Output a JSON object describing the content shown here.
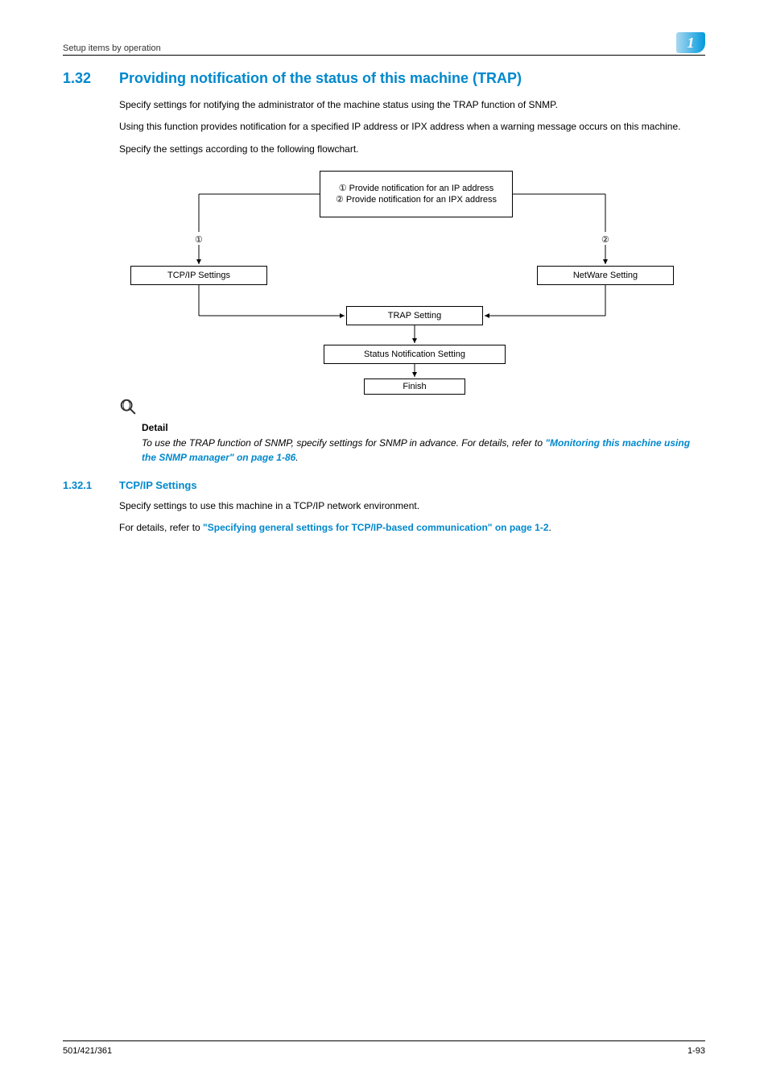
{
  "header": {
    "breadcrumb": "Setup items by operation",
    "chapter_number": "1"
  },
  "section": {
    "number": "1.32",
    "title": "Providing notification of the status of this machine (TRAP)"
  },
  "paragraphs": {
    "p1": "Specify settings for notifying the administrator of the machine status using the TRAP function of SNMP.",
    "p2": "Using this function provides notification for a specified IP address or IPX address when a warning message occurs on this machine.",
    "p3": "Specify the settings according to the following flowchart."
  },
  "flowchart": {
    "top_line1": "① Provide notification for an IP address",
    "top_line2": "② Provide notification for an IPX address",
    "label1": "①",
    "label2": "②",
    "tcpip": "TCP/IP Settings",
    "netware": "NetWare Setting",
    "trap": "TRAP Setting",
    "status": "Status Notification Setting",
    "finish": "Finish"
  },
  "detail": {
    "label": "Detail",
    "text_before_link": "To use the TRAP function of SNMP, specify settings for SNMP in advance. For details, refer to ",
    "link": "\"Monitoring this machine using the SNMP manager\" on page 1-86",
    "text_after_link": "."
  },
  "subsection": {
    "number": "1.32.1",
    "title": "TCP/IP Settings"
  },
  "sub_paragraphs": {
    "sp1": "Specify settings to use this machine in a TCP/IP network environment.",
    "sp2_before": "For details, refer to ",
    "sp2_link": "\"Specifying general settings for TCP/IP-based communication\" on page 1-2",
    "sp2_after": "."
  },
  "footer": {
    "left": "501/421/361",
    "right": "1-93"
  }
}
